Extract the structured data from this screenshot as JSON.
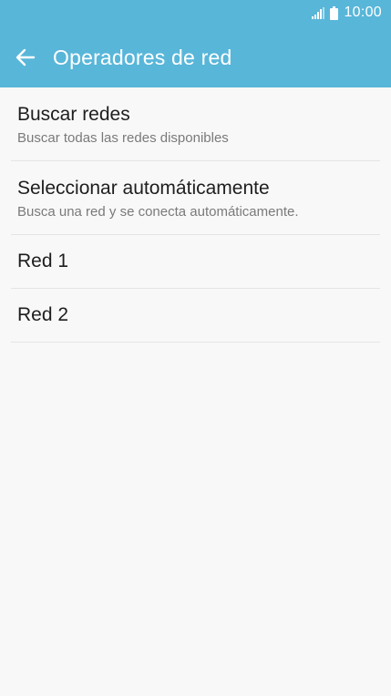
{
  "status_bar": {
    "time": "10:00",
    "icons": [
      "signal-icon",
      "battery-icon"
    ]
  },
  "header": {
    "back_icon": "back-arrow-icon",
    "title": "Operadores de red"
  },
  "colors": {
    "header_bg": "#58b6d9",
    "page_bg": "#f8f8f8",
    "divider": "#e4e4e4"
  },
  "list": {
    "items": [
      {
        "title": "Buscar redes",
        "subtitle": "Buscar todas las redes disponibles"
      },
      {
        "title": "Seleccionar automáticamente",
        "subtitle": "Busca una red y se conecta automáticamente."
      },
      {
        "title": "Red 1"
      },
      {
        "title": "Red 2"
      }
    ]
  }
}
